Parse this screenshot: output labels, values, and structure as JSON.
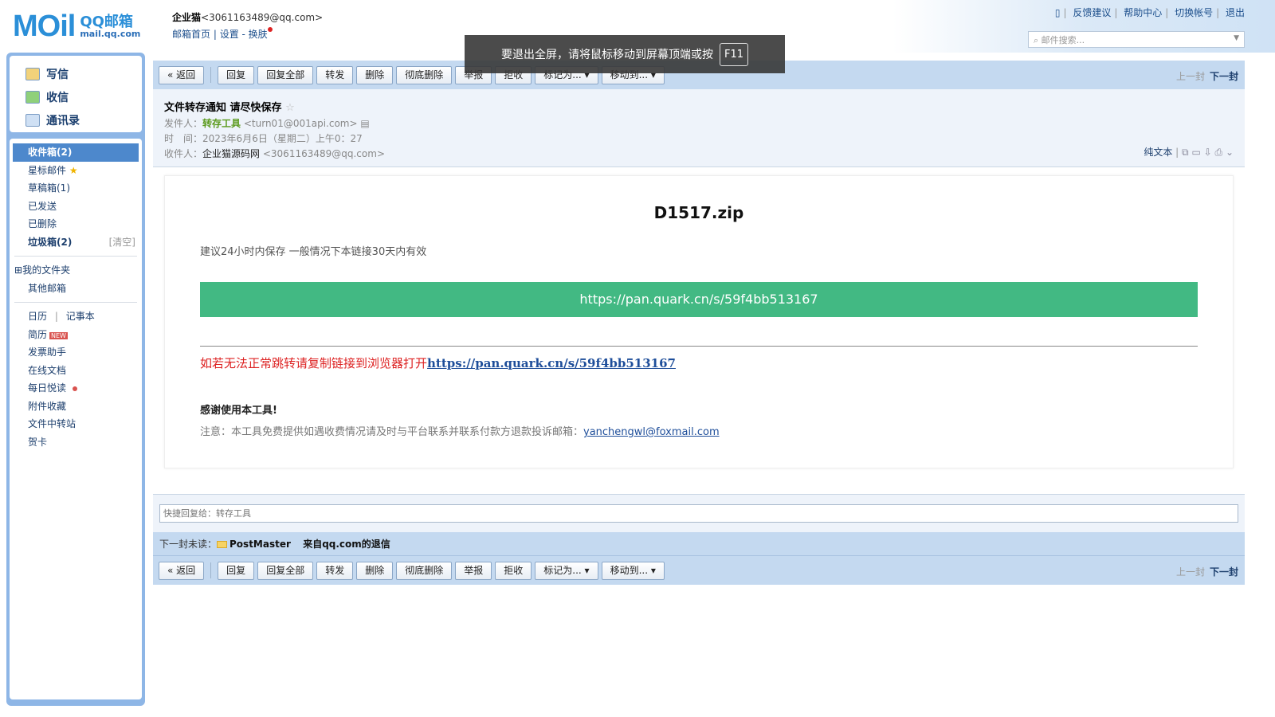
{
  "header": {
    "logo_main": "MOil",
    "logo_sub": "QQ邮箱",
    "logo_domain": "mail.qq.com",
    "user_name": "企业猫",
    "user_email": "<3061163489@qq.com>",
    "links": [
      "邮箱首页",
      "设置",
      "换肤"
    ],
    "top_links": [
      "反馈建议",
      "帮助中心",
      "切换帐号",
      "退出"
    ],
    "search_placeholder": "邮件搜索..."
  },
  "toast": {
    "text": "要退出全屏，请将鼠标移动到屏幕顶端或按",
    "key": "F11"
  },
  "sidebar": {
    "compose": [
      "写信",
      "收信",
      "通讯录"
    ],
    "folders": [
      {
        "label": "收件箱(2)"
      },
      {
        "label": "星标邮件"
      },
      {
        "label": "草稿箱(1)"
      },
      {
        "label": "已发送"
      },
      {
        "label": "已删除"
      },
      {
        "label": "垃圾箱(2)",
        "action": "[清空]"
      }
    ],
    "my_folders": "我的文件夹",
    "other": "其他邮箱",
    "calendar": "日历",
    "notes": "记事本",
    "apps": [
      {
        "label": "简历",
        "badge": "NEW"
      },
      {
        "label": "发票助手"
      },
      {
        "label": "在线文档"
      },
      {
        "label": "每日悦读"
      },
      {
        "label": "附件收藏"
      },
      {
        "label": "文件中转站"
      },
      {
        "label": "贺卡"
      }
    ]
  },
  "toolbar": {
    "buttons": [
      "« 返回",
      "回复",
      "回复全部",
      "转发",
      "删除",
      "彻底删除",
      "举报",
      "拒收",
      "标记为...",
      "移动到..."
    ],
    "prev": "上一封",
    "next": "下一封"
  },
  "mail": {
    "subject": "文件转存通知 请尽快保存",
    "from_label": "发件人：",
    "from_name": "转存工具",
    "from_email": "<turn01@001api.com>",
    "time_label": "时　间：",
    "time": "2023年6月6日（星期二）上午0：27",
    "to_label": "收件人：",
    "to_name": "企业猫源码网",
    "to_email": "<3061163489@qq.com>",
    "plain_text": "纯文本"
  },
  "content": {
    "file": "D1517.zip",
    "tip": "建议24小时内保存 一般情况下本链接30天内有效",
    "link": "https://pan.quark.cn/s/59f4bb513167",
    "fallback": "如若无法正常跳转请复制链接到浏览器打开",
    "thanks": "感谢使用本工具!",
    "note": "注意：本工具免费提供如遇收费情况请及时与平台联系并联系付款方退款投诉邮箱：",
    "email": "yanchengwl@foxmail.com"
  },
  "quick_reply": {
    "placeholder": "快捷回复给：转存工具"
  },
  "next_unread": {
    "label": "下一封未读：",
    "sender": "PostMaster",
    "subject": "来自qq.com的退信"
  }
}
